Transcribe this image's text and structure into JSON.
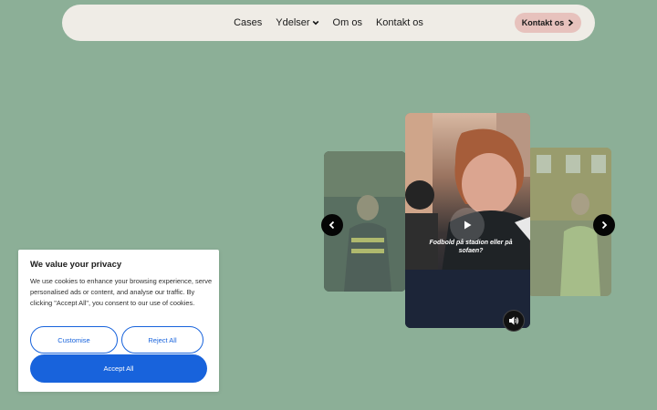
{
  "nav": {
    "links": [
      "Cases",
      "Ydelser",
      "Om os",
      "Kontakt os"
    ],
    "cta_label": "Kontakt os"
  },
  "carousel": {
    "caption": "Fodbold på stadion eller på sofaen?",
    "icons": {
      "prev": "chevron-left-icon",
      "next": "chevron-right-icon",
      "play": "play-icon",
      "sound": "speaker-icon"
    }
  },
  "cookie": {
    "title": "We value your privacy",
    "text": "We use cookies to enhance your browsing experience, serve personalised ads or content, and analyse our traffic. By clicking \"Accept All\", you consent to our use of cookies.",
    "customise_label": "Customise",
    "reject_label": "Reject All",
    "accept_label": "Accept All"
  },
  "colors": {
    "background": "#8caf97",
    "nav_bg": "#efece6",
    "cta_bg": "#e7c2bd",
    "cookie_accent": "#1863dc"
  }
}
